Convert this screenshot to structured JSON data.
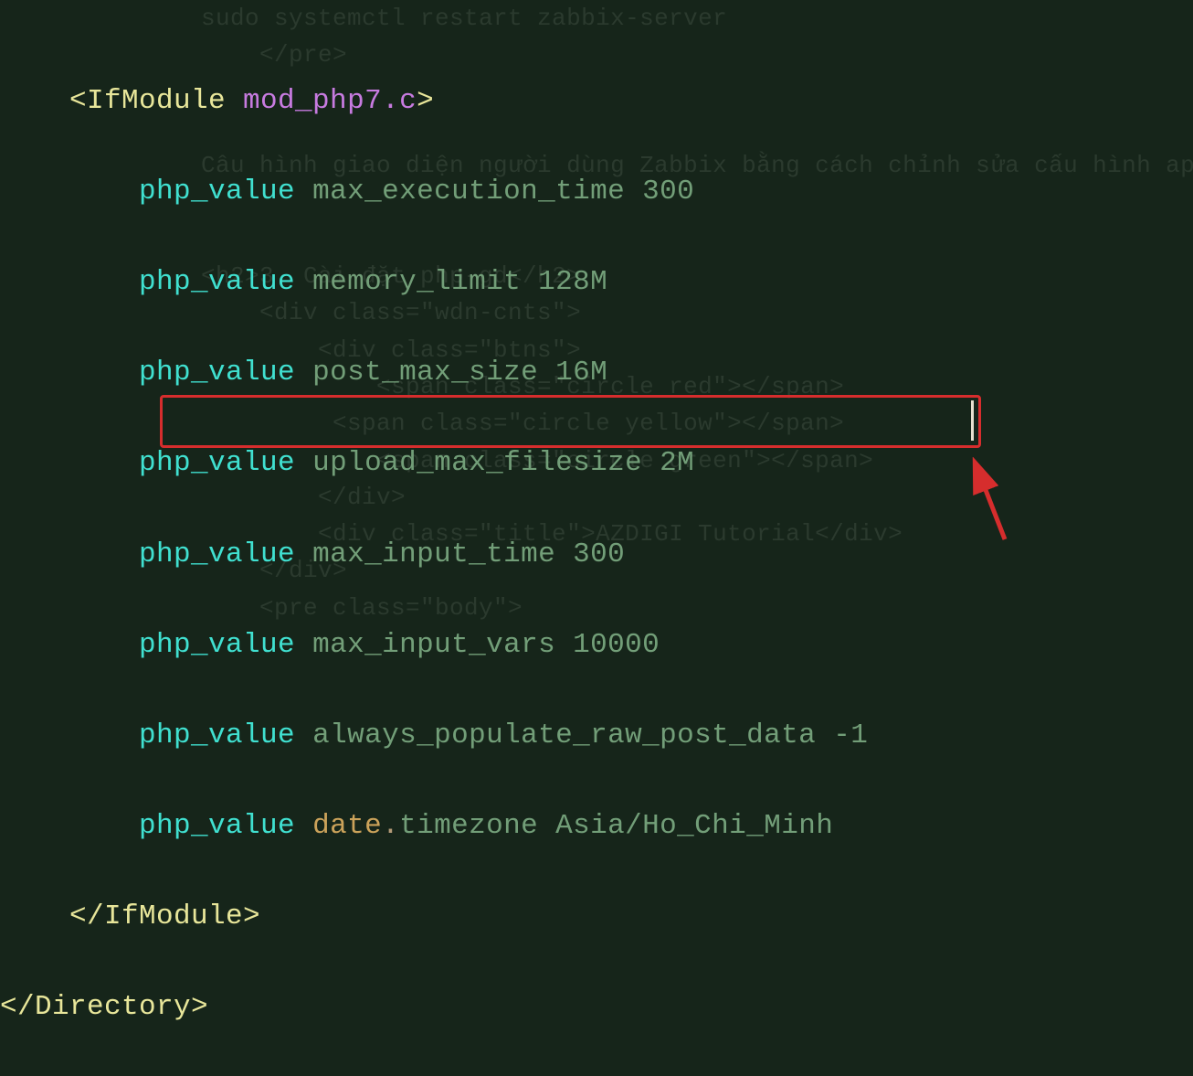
{
  "bg": {
    "l1": "sudo systemctl restart zabbix-server",
    "l2": "    </pre>",
    "l3": "",
    "l4": "",
    "l5": "Câu hình giao diện người dùng Zabbix bằng cách chỉnh sửa cấu hình apache",
    "l6": "",
    "l7": "",
    "l8": "<h2>3. Cài đặt php-gd</h2>",
    "l9": "    <div class=\"wdn-cnts\">",
    "l10": "        <div class=\"btns\">",
    "l11": "            <span class=\"circle red\"></span>",
    "l12": "         <span class=\"circle yellow\"></span>",
    "l13": "            <span class=\"circle green\"></span>",
    "l14": "        </div>",
    "l15": "        <div class=\"title\">AZDIGI Tutorial</div>",
    "l16": "    </div>",
    "l17": "    <pre class=\"body\">"
  },
  "code": {
    "ifmodule_open_pre": "<IfModule ",
    "ifmodule_mod": "mod_php7.c",
    "ifmodule_open_post": ">",
    "indent1": "    ",
    "indent2": "        ",
    "php_value": "php_value",
    "k1": "max_execution_time",
    "v1": "300",
    "k2": "memory_limit",
    "v2": "128M",
    "k3": "post_max_size",
    "v3": "16M",
    "k4": "upload_max_filesize",
    "v4": "2M",
    "k5": "max_input_time",
    "v5": "300",
    "k6": "max_input_vars",
    "v6": "10000",
    "k7": "always_populate_raw_post_data",
    "v7": "-1",
    "k8a": "date",
    "k8b": ".",
    "k8c": "timezone",
    "v8": "Asia/Ho_Chi_Minh",
    "ifmodule_close": "</IfModule>",
    "directory_close": "</Directory>"
  }
}
